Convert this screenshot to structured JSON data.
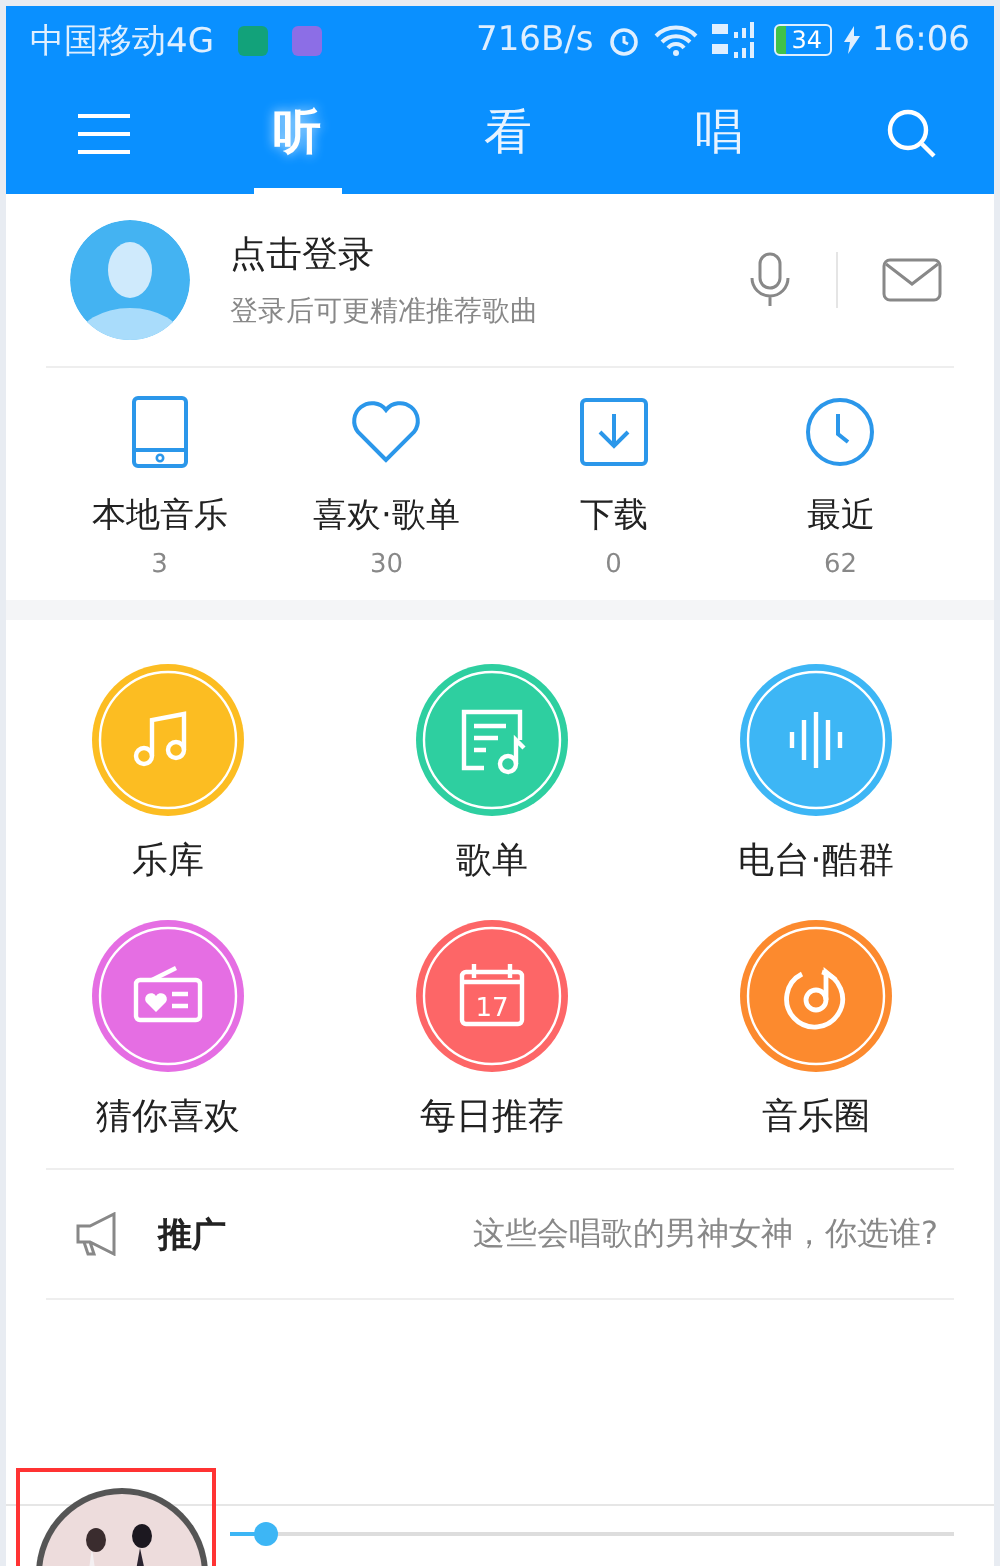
{
  "status_bar": {
    "carrier": "中国移动4G",
    "speed": "716B/s",
    "battery": "34",
    "time": "16:06"
  },
  "tabs": [
    {
      "label": "听",
      "selected": true
    },
    {
      "label": "看",
      "selected": false
    },
    {
      "label": "唱",
      "selected": false
    }
  ],
  "profile": {
    "title": "点击登录",
    "subtitle": "登录后可更精准推荐歌曲"
  },
  "shortcuts": [
    {
      "kind": "phone",
      "label": "本地音乐",
      "count": "3"
    },
    {
      "kind": "heart",
      "label": "喜欢·歌单",
      "count": "30"
    },
    {
      "kind": "download",
      "label": "下载",
      "count": "0"
    },
    {
      "kind": "clock",
      "label": "最近",
      "count": "62"
    }
  ],
  "features": [
    {
      "kind": "notes",
      "label": "乐库",
      "color": "#fcbd22"
    },
    {
      "kind": "list",
      "label": "歌单",
      "color": "#2ecfa0"
    },
    {
      "kind": "wave",
      "label": "电台·酷群",
      "color": "#3db6f5"
    },
    {
      "kind": "radio",
      "label": "猜你喜欢",
      "color": "#e56ee3"
    },
    {
      "kind": "calendar",
      "label": "每日推荐",
      "color": "#fd6667",
      "day": "17"
    },
    {
      "kind": "disc",
      "label": "音乐圈",
      "color": "#fc8a2e"
    }
  ],
  "promo": {
    "label": "推广",
    "text": "这些会唱歌的男神女神，你选谁?"
  },
  "player": {
    "progress": {
      "level": 0.05
    }
  }
}
